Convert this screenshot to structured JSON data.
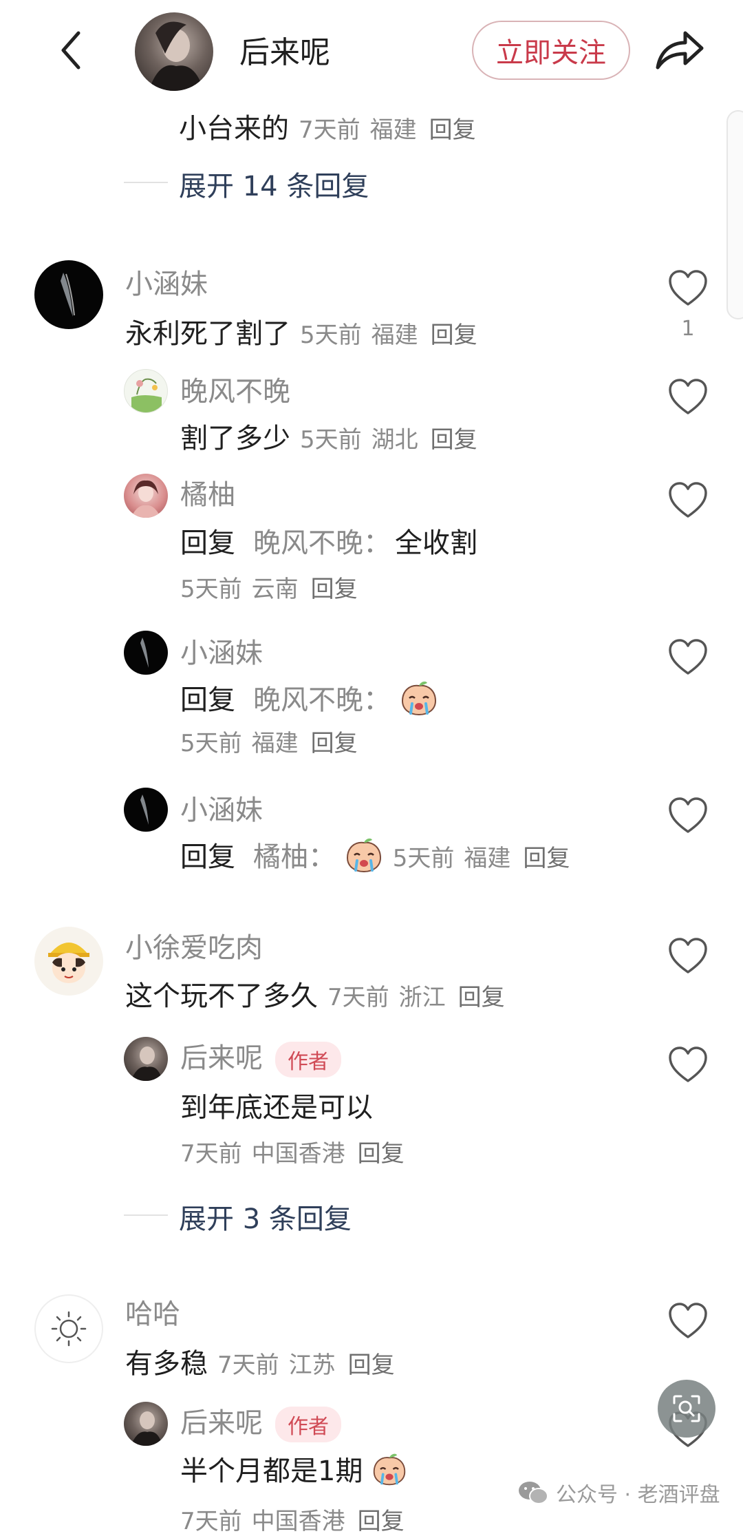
{
  "header": {
    "username": "后来呢",
    "follow_label": "立即关注"
  },
  "top_partial": {
    "text": "小台来的",
    "time": "7天前",
    "location": "福建",
    "reply": "回复",
    "expand": "展开 14 条回复"
  },
  "comments": [
    {
      "name": "小涵妹",
      "text": "永利死了割了",
      "time": "5天前",
      "location": "福建",
      "reply": "回复",
      "likes": "1",
      "replies": [
        {
          "name": "晚风不晚",
          "text": "割了多少",
          "time": "5天前",
          "location": "湖北",
          "reply": "回复"
        },
        {
          "name": "橘柚",
          "reply_prefix": "回复",
          "reply_to": "晚风不晚：",
          "text": "全收割",
          "time": "5天前",
          "location": "云南",
          "reply": "回复"
        },
        {
          "name": "小涵妹",
          "reply_prefix": "回复",
          "reply_to": "晚风不晚：",
          "time": "5天前",
          "location": "福建",
          "reply": "回复"
        },
        {
          "name": "小涵妹",
          "reply_prefix": "回复",
          "reply_to": "橘柚：",
          "time": "5天前",
          "location": "福建",
          "reply": "回复"
        }
      ]
    },
    {
      "name": "小徐爱吃肉",
      "text": "这个玩不了多久",
      "time": "7天前",
      "location": "浙江",
      "reply": "回复",
      "replies": [
        {
          "name": "后来呢",
          "tag": "作者",
          "text": "到年底还是可以",
          "time": "7天前",
          "location": "中国香港",
          "reply": "回复"
        }
      ],
      "expand": "展开 3 条回复"
    },
    {
      "name": "哈哈",
      "text": "有多稳",
      "time": "7天前",
      "location": "江苏",
      "reply": "回复",
      "replies": [
        {
          "name": "后来呢",
          "tag": "作者",
          "text": "半个月都是1期",
          "time": "7天前",
          "location": "中国香港",
          "reply": "回复"
        }
      ]
    }
  ],
  "watermark": {
    "text": "公众号 · 老酒评盘"
  }
}
